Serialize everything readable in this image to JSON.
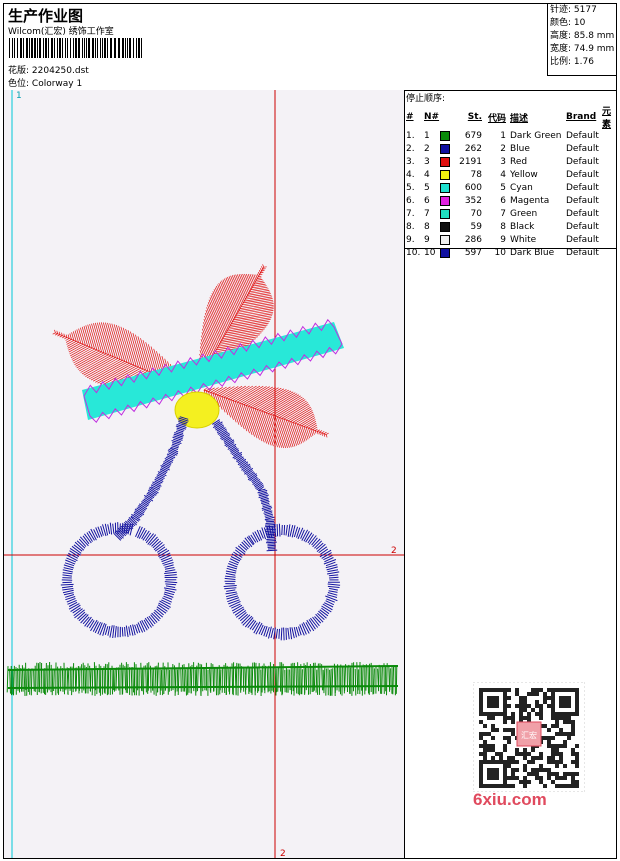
{
  "header": {
    "title": "生产作业图",
    "company": "Wilcom(汇宏) 绣饰工作室",
    "file_label": "花版:",
    "file_value": "2204250.dst",
    "colorway_label": "色位:",
    "colorway_value": "Colorway 1"
  },
  "stats": {
    "stitches": "针迹: 5177",
    "colors": "颜色: 10",
    "height": "高度: 85.8 mm",
    "width": "宽度: 74.9 mm",
    "ratio": "比例: 1.76"
  },
  "stop_sequence": {
    "title": "停止顺序:",
    "headers": [
      "#",
      "N#",
      "St.",
      "代码",
      "描述",
      "Brand",
      "元素"
    ],
    "rows": [
      {
        "idx": "1.",
        "n": "1",
        "color": "#0a8a0a",
        "st": "679",
        "code": "1",
        "desc": "Dark Green",
        "brand": "Default"
      },
      {
        "idx": "2.",
        "n": "2",
        "color": "#1010a0",
        "st": "262",
        "code": "2",
        "desc": "Blue",
        "brand": "Default"
      },
      {
        "idx": "3.",
        "n": "3",
        "color": "#e01010",
        "st": "2191",
        "code": "3",
        "desc": "Red",
        "brand": "Default"
      },
      {
        "idx": "4.",
        "n": "4",
        "color": "#f0f010",
        "st": "78",
        "code": "4",
        "desc": "Yellow",
        "brand": "Default"
      },
      {
        "idx": "5.",
        "n": "5",
        "color": "#20e0d0",
        "st": "600",
        "code": "5",
        "desc": "Cyan",
        "brand": "Default"
      },
      {
        "idx": "6.",
        "n": "6",
        "color": "#e020e0",
        "st": "352",
        "code": "6",
        "desc": "Magenta",
        "brand": "Default"
      },
      {
        "idx": "7.",
        "n": "7",
        "color": "#20e0c0",
        "st": "70",
        "code": "7",
        "desc": "Green",
        "brand": "Default"
      },
      {
        "idx": "8.",
        "n": "8",
        "color": "#101010",
        "st": "59",
        "code": "8",
        "desc": "Black",
        "brand": "Default"
      },
      {
        "idx": "9.",
        "n": "9",
        "color": "#f0f0f0",
        "st": "286",
        "code": "9",
        "desc": "White",
        "brand": "Default"
      },
      {
        "idx": "10.",
        "n": "10",
        "color": "#1010a0",
        "st": "597",
        "code": "10",
        "desc": "Dark Blue",
        "brand": "Default"
      }
    ]
  },
  "canvas": {
    "marker_top": "1",
    "marker_right": "2",
    "marker_bottom": "2"
  },
  "watermark": {
    "brand_text": "6xiu.com",
    "stamp_text": "汇宏"
  },
  "colors": {
    "red": "#e01010",
    "blue": "#1010a0",
    "green": "#0a8a0a",
    "cyan": "#20e0d0",
    "yellow": "#f0f010",
    "magenta": "#e020e0"
  }
}
